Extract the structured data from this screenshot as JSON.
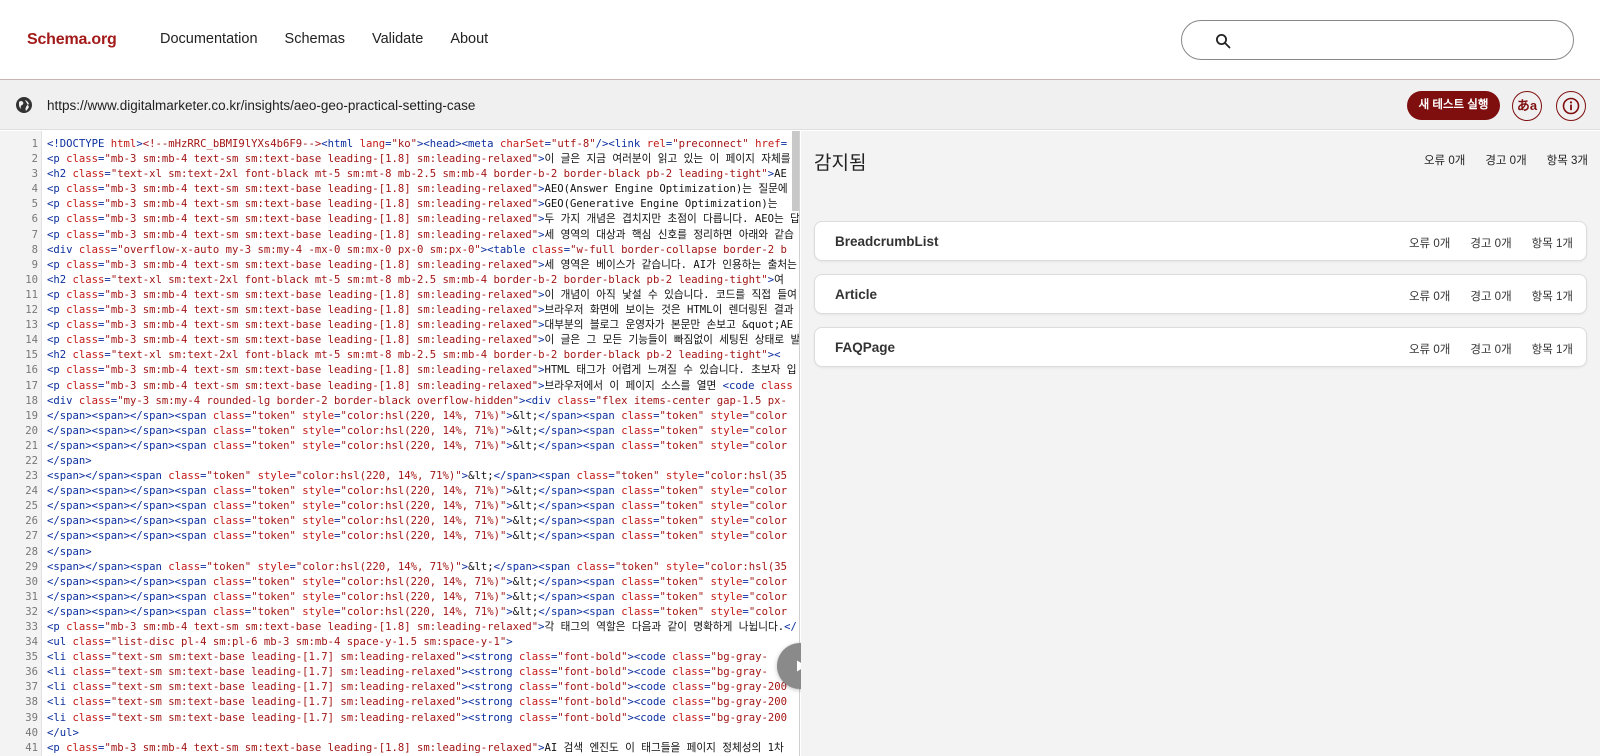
{
  "nav": {
    "logo": "Schema.org",
    "links": [
      "Documentation",
      "Schemas",
      "Validate",
      "About"
    ],
    "search_value": ""
  },
  "urlbar": {
    "url": "https://www.digitalmarketer.co.kr/insights/aeo-geo-practical-setting-case",
    "run_label": "새 테스트 실행",
    "lang_label": "あa",
    "info_label": "ⓘ"
  },
  "code": {
    "lines": [
      "<!DOCTYPE html><!--mHzRRC_bBMI9lYXs4b6F9--><html lang=\"ko\"><head><meta charSet=\"utf-8\"/><link rel=\"preconnect\" href=",
      "<p class=\"mb-3 sm:mb-4 text-sm sm:text-base leading-[1.8] sm:leading-relaxed\">이 글은 지금 여러분이 읽고 있는 이 페이지 자체를",
      "<h2 class=\"text-xl sm:text-2xl font-black mt-5 sm:mt-8 mb-2.5 sm:mb-4 border-b-2 border-black pb-2 leading-tight\">AE",
      "<p class=\"mb-3 sm:mb-4 text-sm sm:text-base leading-[1.8] sm:leading-relaxed\">AEO(Answer Engine Optimization)는 질문에",
      "<p class=\"mb-3 sm:mb-4 text-sm sm:text-base leading-[1.8] sm:leading-relaxed\">GEO(Generative Engine Optimization)는",
      "<p class=\"mb-3 sm:mb-4 text-sm sm:text-base leading-[1.8] sm:leading-relaxed\">두 가지 개념은 겹치지만 초점이 다릅니다. AEO는 답",
      "<p class=\"mb-3 sm:mb-4 text-sm sm:text-base leading-[1.8] sm:leading-relaxed\">세 영역의 대상과 핵심 신호를 정리하면 아래와 같습",
      "<div class=\"overflow-x-auto my-3 sm:my-4 -mx-0 sm:mx-0 px-0 sm:px-0\"><table class=\"w-full border-collapse border-2 b",
      "<p class=\"mb-3 sm:mb-4 text-sm sm:text-base leading-[1.8] sm:leading-relaxed\">세 영역은 베이스가 같습니다. AI가 인용하는 출처는",
      "<h2 class=\"text-xl sm:text-2xl font-black mt-5 sm:mt-8 mb-2.5 sm:mb-4 border-b-2 border-black pb-2 leading-tight\">여",
      "<p class=\"mb-3 sm:mb-4 text-sm sm:text-base leading-[1.8] sm:leading-relaxed\">이 개념이 아직 낯설 수 있습니다. 코드를 직접 들여",
      "<p class=\"mb-3 sm:mb-4 text-sm sm:text-base leading-[1.8] sm:leading-relaxed\">브라우저 화면에 보이는 것은 HTML이 렌더링된 결과",
      "<p class=\"mb-3 sm:mb-4 text-sm sm:text-base leading-[1.8] sm:leading-relaxed\">대부분의 블로그 운영자가 본문만 손보고 &quot;AE",
      "<p class=\"mb-3 sm:mb-4 text-sm sm:text-base leading-[1.8] sm:leading-relaxed\">이 글은 그 모든 기능들이 빠짐없이 세팅된 상태로 발",
      "<h2 class=\"text-xl sm:text-2xl font-black mt-5 sm:mt-8 mb-2.5 sm:mb-4 border-b-2 border-black pb-2 leading-tight\"><",
      "<p class=\"mb-3 sm:mb-4 text-sm sm:text-base leading-[1.8] sm:leading-relaxed\">HTML 태그가 어렵게 느껴질 수 있습니다. 초보자 입",
      "<p class=\"mb-3 sm:mb-4 text-sm sm:text-base leading-[1.8] sm:leading-relaxed\">브라우저에서 이 페이지 소스를 열면 <code class",
      "<div class=\"my-3 sm:my-4 rounded-lg border-2 border-black overflow-hidden\"><div class=\"flex items-center gap-1.5 px-",
      "</span><span></span><span class=\"token\" style=\"color:hsl(220, 14%, 71%)\">&lt;</span><span class=\"token\" style=\"color",
      "</span><span></span><span class=\"token\" style=\"color:hsl(220, 14%, 71%)\">&lt;</span><span class=\"token\" style=\"color",
      "</span><span></span><span class=\"token\" style=\"color:hsl(220, 14%, 71%)\">&lt;</span><span class=\"token\" style=\"color",
      "</span>",
      "<span></span><span class=\"token\" style=\"color:hsl(220, 14%, 71%)\">&lt;</span><span class=\"token\" style=\"color:hsl(35",
      "</span><span></span><span class=\"token\" style=\"color:hsl(220, 14%, 71%)\">&lt;</span><span class=\"token\" style=\"color",
      "</span><span></span><span class=\"token\" style=\"color:hsl(220, 14%, 71%)\">&lt;</span><span class=\"token\" style=\"color",
      "</span><span></span><span class=\"token\" style=\"color:hsl(220, 14%, 71%)\">&lt;</span><span class=\"token\" style=\"color",
      "</span><span></span><span class=\"token\" style=\"color:hsl(220, 14%, 71%)\">&lt;</span><span class=\"token\" style=\"color",
      "</span>",
      "<span></span><span class=\"token\" style=\"color:hsl(220, 14%, 71%)\">&lt;</span><span class=\"token\" style=\"color:hsl(35",
      "</span><span></span><span class=\"token\" style=\"color:hsl(220, 14%, 71%)\">&lt;</span><span class=\"token\" style=\"color",
      "</span><span></span><span class=\"token\" style=\"color:hsl(220, 14%, 71%)\">&lt;</span><span class=\"token\" style=\"color",
      "</span><span></span><span class=\"token\" style=\"color:hsl(220, 14%, 71%)\">&lt;</span><span class=\"token\" style=\"color",
      "<p class=\"mb-3 sm:mb-4 text-sm sm:text-base leading-[1.8] sm:leading-relaxed\">각 태그의 역할은 다음과 같이 명확하게 나뉩니다.</",
      "<ul class=\"list-disc pl-4 sm:pl-6 mb-3 sm:mb-4 space-y-1.5 sm:space-y-1\">",
      "<li class=\"text-sm sm:text-base leading-[1.7] sm:leading-relaxed\"><strong class=\"font-bold\"><code class=\"bg-gray-",
      "<li class=\"text-sm sm:text-base leading-[1.7] sm:leading-relaxed\"><strong class=\"font-bold\"><code class=\"bg-gray-",
      "<li class=\"text-sm sm:text-base leading-[1.7] sm:leading-relaxed\"><strong class=\"font-bold\"><code class=\"bg-gray-200",
      "<li class=\"text-sm sm:text-base leading-[1.7] sm:leading-relaxed\"><strong class=\"font-bold\"><code class=\"bg-gray-200",
      "<li class=\"text-sm sm:text-base leading-[1.7] sm:leading-relaxed\"><strong class=\"font-bold\"><code class=\"bg-gray-200",
      "</ul>",
      "<p class=\"mb-3 sm:mb-4 text-sm sm:text-base leading-[1.8] sm:leading-relaxed\">AI 검색 엔진도 이 태그들을 페이지 정체성의 1차"
    ]
  },
  "results": {
    "title": "감지됨",
    "summary": {
      "errors": "오류 0개",
      "warnings": "경고 0개",
      "items": "항목 3개"
    },
    "cards": [
      {
        "name": "BreadcrumbList",
        "errors": "오류 0개",
        "warnings": "경고 0개",
        "items": "항목 1개"
      },
      {
        "name": "Article",
        "errors": "오류 0개",
        "warnings": "경고 0개",
        "items": "항목 1개"
      },
      {
        "name": "FAQPage",
        "errors": "오류 0개",
        "warnings": "경고 0개",
        "items": "항목 1개"
      }
    ]
  },
  "colors": {
    "brand": "#a31a1a",
    "run_button": "#7f0f0f",
    "panel_bg": "#f3f3f3",
    "code_tag": "#0b2f9e",
    "code_attr": "#c41a16",
    "code_value": "#a31515"
  },
  "icons": {
    "search": "search-icon",
    "globe": "globe-icon",
    "language": "language-icon",
    "info": "info-icon",
    "play": "play-icon"
  }
}
